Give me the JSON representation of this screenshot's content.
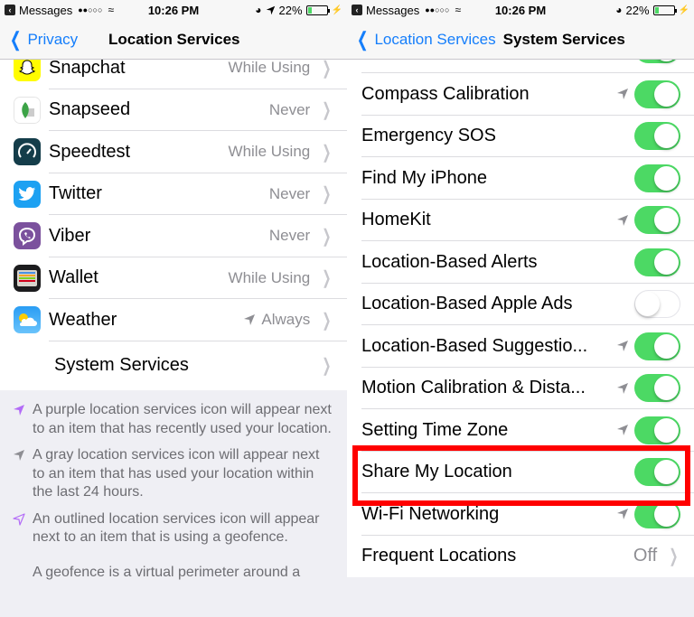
{
  "status_bar": {
    "back_app": "Messages",
    "signal": "●●○○○",
    "time": "10:26 PM",
    "battery": "22%",
    "battery_level": 0.22
  },
  "left": {
    "nav": {
      "back_label": "Privacy",
      "title": "Location Services"
    },
    "apps": [
      {
        "name": "Snapchat",
        "value": "While Using",
        "icon": "snapchat-icon",
        "arrow": null
      },
      {
        "name": "Snapseed",
        "value": "Never",
        "icon": "snapseed-icon",
        "arrow": null
      },
      {
        "name": "Speedtest",
        "value": "While Using",
        "icon": "speedtest-icon",
        "arrow": null
      },
      {
        "name": "Twitter",
        "value": "Never",
        "icon": "twitter-icon",
        "arrow": null
      },
      {
        "name": "Viber",
        "value": "Never",
        "icon": "viber-icon",
        "arrow": null
      },
      {
        "name": "Wallet",
        "value": "While Using",
        "icon": "wallet-icon",
        "arrow": null
      },
      {
        "name": "Weather",
        "value": "Always",
        "icon": "weather-icon",
        "arrow": "gray"
      }
    ],
    "system_services": "System Services",
    "footer": {
      "notes": [
        {
          "icon": "purple",
          "text": "A purple location services icon will appear next to an item that has recently used your location."
        },
        {
          "icon": "gray",
          "text": "A gray location services icon will appear next to an item that has used your location within the last 24 hours."
        },
        {
          "icon": "outlined",
          "text": "An outlined location services icon will appear next to an item that is using a geofence."
        }
      ],
      "geofence": "A geofence is a virtual perimeter around a"
    }
  },
  "right": {
    "nav": {
      "back_label": "Location Services",
      "title": "System Services"
    },
    "services": [
      {
        "name": "Compass Calibration",
        "on": true,
        "arrow": true
      },
      {
        "name": "Emergency SOS",
        "on": true,
        "arrow": false
      },
      {
        "name": "Find My iPhone",
        "on": true,
        "arrow": false
      },
      {
        "name": "HomeKit",
        "on": true,
        "arrow": true
      },
      {
        "name": "Location-Based Alerts",
        "on": true,
        "arrow": false
      },
      {
        "name": "Location-Based Apple Ads",
        "on": false,
        "arrow": false
      },
      {
        "name": "Location-Based Suggestio...",
        "on": true,
        "arrow": true
      },
      {
        "name": "Motion Calibration & Dista...",
        "on": true,
        "arrow": true
      },
      {
        "name": "Setting Time Zone",
        "on": true,
        "arrow": true
      },
      {
        "name": "Share My Location",
        "on": true,
        "arrow": false,
        "highlighted": true
      },
      {
        "name": "Wi-Fi Networking",
        "on": true,
        "arrow": true
      }
    ],
    "frequent_locations": {
      "name": "Frequent Locations",
      "value": "Off"
    }
  },
  "colors": {
    "accent": "#157efb",
    "switch_on": "#4cd964",
    "highlight": "#ff0000",
    "purple_arrow": "#b36cf7",
    "gray_arrow": "#8e8e93"
  }
}
